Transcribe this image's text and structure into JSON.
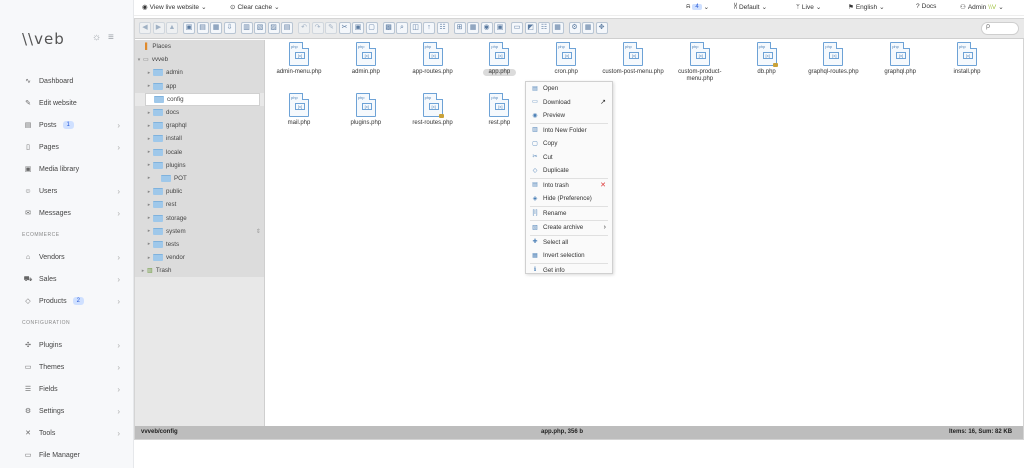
{
  "brand": {
    "logo": "\\\\veb"
  },
  "topbar": {
    "view_live": "View live website",
    "clear_cache": "Clear cache",
    "notif_count": "4",
    "theme": "Default",
    "mode": "Live",
    "language": "English",
    "docs": "Docs",
    "user": "Admin"
  },
  "sidebar": {
    "items": [
      {
        "label": "Dashboard",
        "icon": "activity-icon"
      },
      {
        "label": "Edit website",
        "icon": "edit-icon"
      },
      {
        "label": "Posts",
        "icon": "document-icon",
        "badge": "1"
      },
      {
        "label": "Pages",
        "icon": "page-icon"
      },
      {
        "label": "Media library",
        "icon": "image-icon"
      },
      {
        "label": "Users",
        "icon": "users-icon"
      },
      {
        "label": "Messages",
        "icon": "mail-icon"
      }
    ],
    "ecommerce_heading": "ECOMMERCE",
    "ecommerce": [
      {
        "label": "Vendors",
        "icon": "store-icon"
      },
      {
        "label": "Sales",
        "icon": "cart-icon"
      },
      {
        "label": "Products",
        "icon": "box-icon",
        "badge": "2"
      }
    ],
    "config_heading": "CONFIGURATION",
    "config": [
      {
        "label": "Plugins",
        "icon": "plugin-icon"
      },
      {
        "label": "Themes",
        "icon": "theme-icon"
      },
      {
        "label": "Fields",
        "icon": "fields-icon"
      },
      {
        "label": "Settings",
        "icon": "gear-icon"
      },
      {
        "label": "Tools",
        "icon": "tools-icon"
      },
      {
        "label": "File Manager",
        "icon": "folder-icon"
      }
    ]
  },
  "tree": {
    "places": "Places",
    "root": "vvveb",
    "folders": [
      "admin",
      "app",
      "config",
      "docs",
      "graphql",
      "install",
      "locale",
      "plugins",
      "POT",
      "public",
      "rest",
      "storage",
      "system",
      "tests",
      "vendor"
    ],
    "trash": "Trash"
  },
  "files": [
    {
      "name": "admin-menu.php"
    },
    {
      "name": "admin.php"
    },
    {
      "name": "app-routes.php"
    },
    {
      "name": "app.php"
    },
    {
      "name": "cron.php"
    },
    {
      "name": "custom-post-menu.php"
    },
    {
      "name": "custom-product-menu.php"
    },
    {
      "name": "db.php"
    },
    {
      "name": "graphql-routes.php"
    },
    {
      "name": "graphql.php"
    },
    {
      "name": "install.php"
    },
    {
      "name": "mail.php"
    },
    {
      "name": "plugins.php"
    },
    {
      "name": "rest-routes.php"
    },
    {
      "name": "rest.php"
    }
  ],
  "context_menu": [
    {
      "label": "Open",
      "icon": "open-icon"
    },
    {
      "label": "Download",
      "icon": "download-icon"
    },
    {
      "label": "Preview",
      "icon": "eye-icon"
    },
    {
      "label": "Into New Folder",
      "icon": "new-folder-icon"
    },
    {
      "label": "Copy",
      "icon": "copy-icon"
    },
    {
      "label": "Cut",
      "icon": "cut-icon"
    },
    {
      "label": "Duplicate",
      "icon": "duplicate-icon"
    },
    {
      "label": "Into trash",
      "icon": "trash-icon"
    },
    {
      "label": "Hide (Preference)",
      "icon": "hide-icon"
    },
    {
      "label": "Rename",
      "icon": "rename-icon"
    },
    {
      "label": "Create archive",
      "icon": "archive-icon"
    },
    {
      "label": "Select all",
      "icon": "select-all-icon"
    },
    {
      "label": "Invert selection",
      "icon": "invert-icon"
    },
    {
      "label": "Get info",
      "icon": "info-icon"
    }
  ],
  "status": {
    "path": "vvveb/config",
    "selection": "app.php, 356 b",
    "summary": "Items: 16, Sum: 82 KB"
  },
  "search": {
    "placeholder": "ρ"
  }
}
